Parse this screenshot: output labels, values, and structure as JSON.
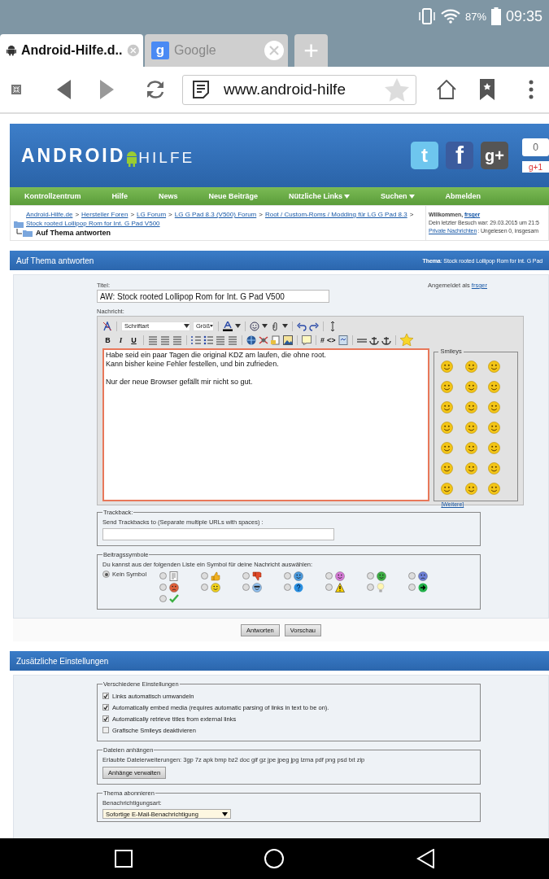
{
  "status_bar": {
    "battery": "87%",
    "time": "09:35"
  },
  "browser_tabs": [
    {
      "title": "Android-Hilfe.d..",
      "selected": true,
      "kind": "android"
    },
    {
      "title": "Google",
      "selected": false,
      "kind": "google",
      "glyph": "g"
    }
  ],
  "new_tab": "+",
  "address_bar": {
    "url": "www.android-hilfe"
  },
  "site": {
    "logo_main": "ANDROID",
    "logo_sub": "HILFE",
    "social": [
      {
        "kind": "twitter",
        "glyph": "t"
      },
      {
        "kind": "facebook",
        "glyph": "f"
      },
      {
        "kind": "gplus",
        "glyph": "g+"
      }
    ],
    "plus_count": "0",
    "plus_button": "g+1",
    "nav": [
      {
        "label": "Kontrollzentrum",
        "dropdown": false
      },
      {
        "label": "Hilfe",
        "dropdown": false
      },
      {
        "label": "News",
        "dropdown": false
      },
      {
        "label": "Neue Beiträge",
        "dropdown": false
      },
      {
        "label": "Nützliche Links",
        "dropdown": true
      },
      {
        "label": "Suchen",
        "dropdown": true
      },
      {
        "label": "Abmelden",
        "dropdown": false
      }
    ]
  },
  "breadcrumb": {
    "links": [
      "Android-Hilfe.de",
      "Hersteller Foren",
      "LG Forum",
      "LG G Pad 8.3 (V500) Forum",
      "Root / Custom-Roms / Modding für LG G Pad 8.3"
    ],
    "separator": ">",
    "thread": "Stock rooted Lollipop Rom for Int. G Pad V500",
    "current": "Auf Thema antworten"
  },
  "welcome": {
    "greeting": "Willkommen,",
    "user": "frsger",
    "last_visit": "Dein letzter Besuch war: 29.03.2015 um 21:5",
    "pm_link": "Private Nachrichten",
    "pm_text": ": Ungelesen 0, insgesam"
  },
  "reply": {
    "heading": "Auf Thema antworten",
    "thread": "**Thema**: Stock rooted Lollipop Rom for Int. G Pad",
    "title_label": "Titel:",
    "title_value": "AW: Stock rooted Lollipop Rom for Int. G Pad V500",
    "logged_in": "Angemeldet als",
    "logged_user": "frsger",
    "message_label": "Nachricht:",
    "font_select": "Schriftart",
    "size_select": "Größ",
    "format_buttons": [
      "B",
      "I",
      "U"
    ],
    "code_buttons": [
      "#",
      "<>"
    ],
    "message_paragraphs": [
      [
        "Habe seid ein paar Tagen die original KDZ am laufen,  die ohne root.",
        "Kann bisher keine Fehler festellen,  und bin zufrieden."
      ],
      [
        "Nur der neue Browser gefällt mir nicht so gut."
      ]
    ],
    "smileys_label": "Smileys",
    "smileys_more": "[Weitere]"
  },
  "trackback": {
    "legend": "Trackback:",
    "label": "Send Trackbacks to (Separate multiple URLs with spaces) :"
  },
  "post_icons": {
    "legend": "Beitragssymbole",
    "hint": "Du kannst aus der folgenden Liste ein Symbol für deine Nachricht auswählen:",
    "options": [
      {
        "kind": "none",
        "label": "Kein Symbol",
        "selected": true
      },
      {
        "kind": "note",
        "selected": false
      },
      {
        "kind": "thumb-up",
        "selected": false
      },
      {
        "kind": "thumb-down",
        "selected": false
      },
      {
        "kind": "smile-blue",
        "selected": false
      },
      {
        "kind": "smile-pink",
        "selected": false
      },
      {
        "kind": "grin",
        "selected": false
      },
      {
        "kind": "sad",
        "selected": false
      },
      {
        "kind": "angry",
        "selected": false
      },
      {
        "kind": "smile",
        "selected": false
      },
      {
        "kind": "cool",
        "selected": false
      },
      {
        "kind": "question",
        "selected": false
      },
      {
        "kind": "warning",
        "selected": false
      },
      {
        "kind": "bulb",
        "selected": false
      },
      {
        "kind": "arrow",
        "selected": false
      },
      {
        "kind": "check",
        "selected": false
      }
    ]
  },
  "buttons": [
    "Antworten",
    "Vorschau"
  ],
  "extra": {
    "heading": "Zusätzliche Einstellungen",
    "misc": {
      "legend": "Verschiedene Einstellungen",
      "options": [
        {
          "label": "Links automatisch umwandeln",
          "checked": true
        },
        {
          "label": "Automatically embed media (requires automatic parsing of links in text to be on).",
          "checked": true
        },
        {
          "label": "Automatically retrieve titles from external links",
          "checked": true
        },
        {
          "label": "Grafische Smileys deaktivieren",
          "checked": false
        }
      ]
    },
    "attach": {
      "legend": "Dateien anhängen",
      "allowed": "Erlaubte Dateierweiterungen: 3gp 7z apk bmp bz2 doc gif gz jpe jpeg jpg lzma pdf png psd txt zip",
      "button": "Anhänge verwalten"
    },
    "subscribe": {
      "legend": "Thema abonnieren",
      "label": "Benachrichtigungsart:",
      "value": "Sofortige E-Mail-Benachrichtigung"
    }
  }
}
